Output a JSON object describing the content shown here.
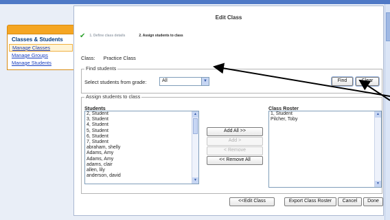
{
  "window": {
    "title": "Edit Class"
  },
  "sidebar": {
    "heading": "Classes & Students",
    "items": [
      {
        "label": "Manage Classes",
        "active": true
      },
      {
        "label": "Manage Groups",
        "active": false
      },
      {
        "label": "Manage Students",
        "active": false
      }
    ]
  },
  "steps": {
    "step1": "1. Define class details",
    "step2": "2. Assign students to class"
  },
  "class_info": {
    "label": "Class:",
    "value": "Practice Class"
  },
  "find": {
    "legend": "Find students",
    "select_label": "Select students from grade:",
    "grade_value": "All",
    "find_button": "Find",
    "clear_button": "Clear"
  },
  "assign": {
    "legend": "Assign students to class",
    "students_header": "Students",
    "roster_header": "Class Roster",
    "students": [
      "2, Student",
      "3, Student",
      "4, Student",
      "5, Student",
      "6, Student",
      "7, Student",
      "abraham, shelly",
      "Adams, Amy",
      "Adams, Amy",
      "adams, clair",
      "allen, lily",
      "anderson, david"
    ],
    "roster": [
      "1, Student",
      "Pilcher, Toby"
    ],
    "buttons": {
      "add_all": "Add All >>",
      "add": "Add >",
      "remove": "< Remove",
      "remove_all": "<< Remove All"
    }
  },
  "footer": {
    "edit_class": "<<Edit Class",
    "export": "Export Class Roster",
    "cancel": "Cancel",
    "done": "Done"
  },
  "colors": {
    "accent": "#f5a623",
    "link": "#1a3fbf",
    "check": "#2aa02a"
  }
}
